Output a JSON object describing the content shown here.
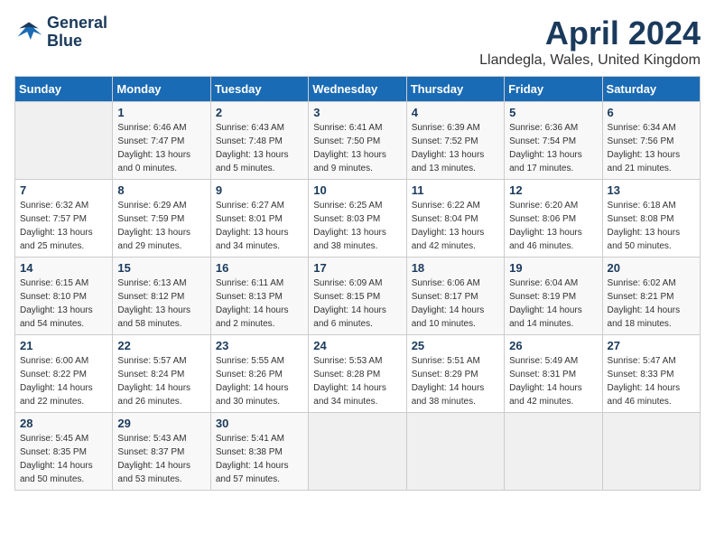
{
  "header": {
    "logo_line1": "General",
    "logo_line2": "Blue",
    "month_title": "April 2024",
    "location": "Llandegla, Wales, United Kingdom"
  },
  "days_of_week": [
    "Sunday",
    "Monday",
    "Tuesday",
    "Wednesday",
    "Thursday",
    "Friday",
    "Saturday"
  ],
  "weeks": [
    [
      {
        "num": "",
        "empty": true
      },
      {
        "num": "1",
        "sunrise": "6:46 AM",
        "sunset": "7:47 PM",
        "daylight": "13 hours and 0 minutes."
      },
      {
        "num": "2",
        "sunrise": "6:43 AM",
        "sunset": "7:48 PM",
        "daylight": "13 hours and 5 minutes."
      },
      {
        "num": "3",
        "sunrise": "6:41 AM",
        "sunset": "7:50 PM",
        "daylight": "13 hours and 9 minutes."
      },
      {
        "num": "4",
        "sunrise": "6:39 AM",
        "sunset": "7:52 PM",
        "daylight": "13 hours and 13 minutes."
      },
      {
        "num": "5",
        "sunrise": "6:36 AM",
        "sunset": "7:54 PM",
        "daylight": "13 hours and 17 minutes."
      },
      {
        "num": "6",
        "sunrise": "6:34 AM",
        "sunset": "7:56 PM",
        "daylight": "13 hours and 21 minutes."
      }
    ],
    [
      {
        "num": "7",
        "sunrise": "6:32 AM",
        "sunset": "7:57 PM",
        "daylight": "13 hours and 25 minutes."
      },
      {
        "num": "8",
        "sunrise": "6:29 AM",
        "sunset": "7:59 PM",
        "daylight": "13 hours and 29 minutes."
      },
      {
        "num": "9",
        "sunrise": "6:27 AM",
        "sunset": "8:01 PM",
        "daylight": "13 hours and 34 minutes."
      },
      {
        "num": "10",
        "sunrise": "6:25 AM",
        "sunset": "8:03 PM",
        "daylight": "13 hours and 38 minutes."
      },
      {
        "num": "11",
        "sunrise": "6:22 AM",
        "sunset": "8:04 PM",
        "daylight": "13 hours and 42 minutes."
      },
      {
        "num": "12",
        "sunrise": "6:20 AM",
        "sunset": "8:06 PM",
        "daylight": "13 hours and 46 minutes."
      },
      {
        "num": "13",
        "sunrise": "6:18 AM",
        "sunset": "8:08 PM",
        "daylight": "13 hours and 50 minutes."
      }
    ],
    [
      {
        "num": "14",
        "sunrise": "6:15 AM",
        "sunset": "8:10 PM",
        "daylight": "13 hours and 54 minutes."
      },
      {
        "num": "15",
        "sunrise": "6:13 AM",
        "sunset": "8:12 PM",
        "daylight": "13 hours and 58 minutes."
      },
      {
        "num": "16",
        "sunrise": "6:11 AM",
        "sunset": "8:13 PM",
        "daylight": "14 hours and 2 minutes."
      },
      {
        "num": "17",
        "sunrise": "6:09 AM",
        "sunset": "8:15 PM",
        "daylight": "14 hours and 6 minutes."
      },
      {
        "num": "18",
        "sunrise": "6:06 AM",
        "sunset": "8:17 PM",
        "daylight": "14 hours and 10 minutes."
      },
      {
        "num": "19",
        "sunrise": "6:04 AM",
        "sunset": "8:19 PM",
        "daylight": "14 hours and 14 minutes."
      },
      {
        "num": "20",
        "sunrise": "6:02 AM",
        "sunset": "8:21 PM",
        "daylight": "14 hours and 18 minutes."
      }
    ],
    [
      {
        "num": "21",
        "sunrise": "6:00 AM",
        "sunset": "8:22 PM",
        "daylight": "14 hours and 22 minutes."
      },
      {
        "num": "22",
        "sunrise": "5:57 AM",
        "sunset": "8:24 PM",
        "daylight": "14 hours and 26 minutes."
      },
      {
        "num": "23",
        "sunrise": "5:55 AM",
        "sunset": "8:26 PM",
        "daylight": "14 hours and 30 minutes."
      },
      {
        "num": "24",
        "sunrise": "5:53 AM",
        "sunset": "8:28 PM",
        "daylight": "14 hours and 34 minutes."
      },
      {
        "num": "25",
        "sunrise": "5:51 AM",
        "sunset": "8:29 PM",
        "daylight": "14 hours and 38 minutes."
      },
      {
        "num": "26",
        "sunrise": "5:49 AM",
        "sunset": "8:31 PM",
        "daylight": "14 hours and 42 minutes."
      },
      {
        "num": "27",
        "sunrise": "5:47 AM",
        "sunset": "8:33 PM",
        "daylight": "14 hours and 46 minutes."
      }
    ],
    [
      {
        "num": "28",
        "sunrise": "5:45 AM",
        "sunset": "8:35 PM",
        "daylight": "14 hours and 50 minutes."
      },
      {
        "num": "29",
        "sunrise": "5:43 AM",
        "sunset": "8:37 PM",
        "daylight": "14 hours and 53 minutes."
      },
      {
        "num": "30",
        "sunrise": "5:41 AM",
        "sunset": "8:38 PM",
        "daylight": "14 hours and 57 minutes."
      },
      {
        "num": "",
        "empty": true
      },
      {
        "num": "",
        "empty": true
      },
      {
        "num": "",
        "empty": true
      },
      {
        "num": "",
        "empty": true
      }
    ]
  ]
}
